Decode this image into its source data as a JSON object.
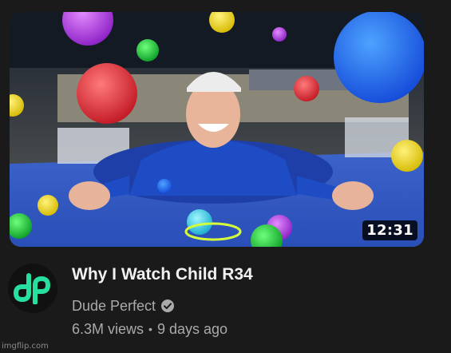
{
  "video": {
    "title": "Why I Watch Child R34",
    "duration": "12:31",
    "channel": "Dude Perfect",
    "views": "6.3M views",
    "separator": "•",
    "age": "9 days ago"
  },
  "channel_logo": {
    "text": "dp",
    "color": "#27e0a0"
  },
  "icons": {
    "verified": "verified-check-icon"
  },
  "watermark": "imgflip.com"
}
